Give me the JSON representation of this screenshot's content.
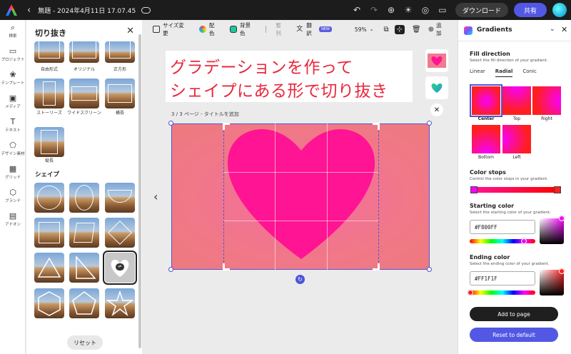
{
  "topbar": {
    "doc_title": "無題 - 2024年4月11日 17.07.45",
    "download_label": "ダウンロード",
    "share_label": "共有"
  },
  "rail": [
    {
      "icon": "search-icon",
      "label": "検索"
    },
    {
      "icon": "folder-icon",
      "label": "プロジェクト"
    },
    {
      "icon": "template-icon",
      "label": "テンプレート"
    },
    {
      "icon": "media-icon",
      "label": "メディア"
    },
    {
      "icon": "text-icon",
      "label": "テキスト"
    },
    {
      "icon": "design-assets-icon",
      "label": "デザイン素材"
    },
    {
      "icon": "grid-icon",
      "label": "グリッド"
    },
    {
      "icon": "brand-icon",
      "label": "ブランド"
    },
    {
      "icon": "addon-icon",
      "label": "アドオン"
    }
  ],
  "panel": {
    "title": "切り抜き",
    "frames": [
      "自由形式",
      "オリジナル",
      "正方形",
      "ストーリーズ",
      "ワイドスクリーン",
      "横長",
      "縦長"
    ],
    "shapes_heading": "シェイプ",
    "reset_label": "リセット"
  },
  "canvas_toolbar": {
    "resize": "サイズ変更",
    "color": "配色",
    "background": "背景色",
    "arrange": "整列",
    "translate": "翻訳",
    "new_badge": "NEW",
    "zoom": "59%",
    "add": "追加"
  },
  "canvas": {
    "overlay_line1": "グラデーションを作って",
    "overlay_line2": "シェイプにある形で切り抜き",
    "page_caption": "3 / 3 ページ - タイトルを追加"
  },
  "gradients": {
    "title": "Gradients",
    "fill_direction_title": "Fill direction",
    "fill_direction_sub": "Select the fill direction of your gradient.",
    "tabs": [
      "Linear",
      "Radial",
      "Conic"
    ],
    "active_tab": "Radial",
    "swatches": [
      "Center",
      "Top",
      "Right",
      "Bottom",
      "Left"
    ],
    "selected_swatch": "Center",
    "color_stops_title": "Color stops",
    "color_stops_sub": "Control the color stops in your gradient.",
    "starting_title": "Starting color",
    "starting_sub": "Select the starting color of your gradient.",
    "starting_hex": "#F800FF",
    "ending_title": "Ending color",
    "ending_sub": "Select the ending color of your gradient.",
    "ending_hex": "#FF1F1F",
    "add_label": "Add to page",
    "reset_label": "Reset to default"
  },
  "colors": {
    "accent": "#5258e4",
    "start": "#F800FF",
    "end": "#FF1F1F",
    "heart": "#ff1493",
    "title_text": "#e8283c"
  }
}
